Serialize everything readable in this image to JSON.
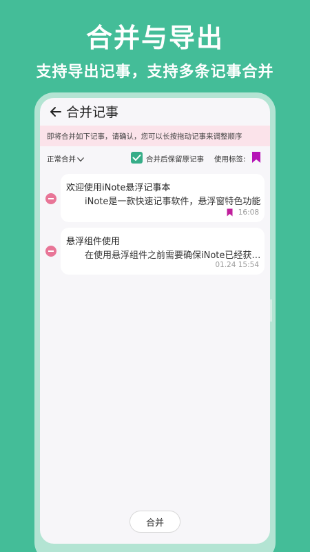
{
  "promo": {
    "title": "合并与导出",
    "subtitle": "支持导出记事，支持多条记事合并"
  },
  "header": {
    "title": "合并记事",
    "back_icon": "arrow-left-icon"
  },
  "notice": "即将合并如下记事，请确认，您可以长按拖动记事来调整顺序",
  "options": {
    "mode": "正常合并",
    "keep_original_checked": true,
    "keep_original_label": "合并后保留原记事",
    "tag_label": "使用标签:",
    "tag_color": "#b514b6"
  },
  "notes": [
    {
      "title": "欢迎使用iNote悬浮记事本",
      "preview": "iNote是一款快速记事软件，悬浮窗特色功能",
      "time": "16:08",
      "bookmarked": true,
      "bookmark_color": "#c01f9c"
    },
    {
      "title": "悬浮组件使用",
      "preview": "在使用悬浮组件之前需要确保iNote已经获取权限",
      "time": "01.24 15:54",
      "bookmarked": false
    }
  ],
  "actions": {
    "merge_label": "合并"
  },
  "colors": {
    "background": "#44bd98",
    "accent": "#36ad88",
    "remove": "#e87597",
    "notice_bg": "#fbe3ea"
  }
}
